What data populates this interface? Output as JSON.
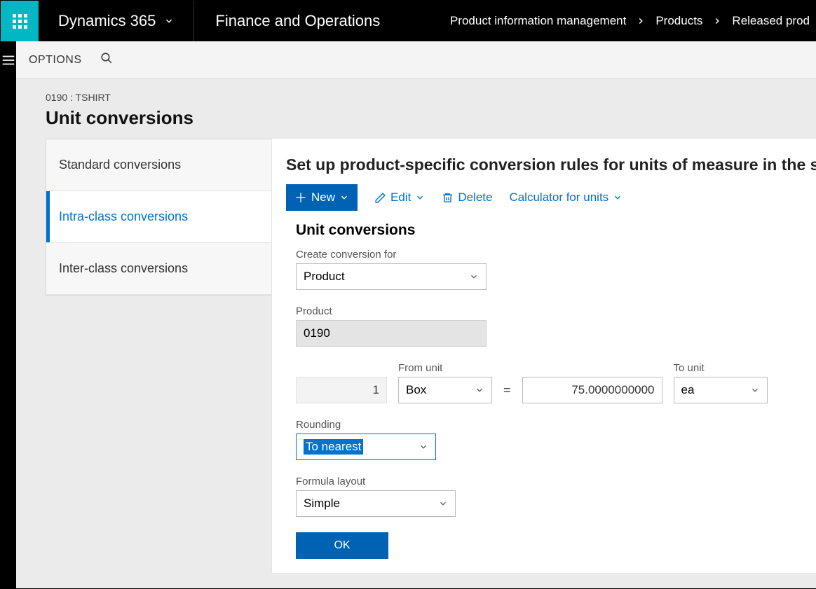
{
  "header": {
    "brand": "Dynamics 365",
    "module": "Finance and Operations",
    "breadcrumbs": [
      "Product information management",
      "Products",
      "Released prod"
    ]
  },
  "options_bar": {
    "label": "OPTIONS"
  },
  "page": {
    "caption": "0190 : TSHIRT",
    "title": "Unit conversions"
  },
  "side_tabs": [
    {
      "label": "Standard conversions",
      "active": false
    },
    {
      "label": "Intra-class conversions",
      "active": true
    },
    {
      "label": "Inter-class conversions",
      "active": false
    }
  ],
  "panel": {
    "heading": "Set up product-specific conversion rules for units of measure in the sam",
    "toolbar": {
      "new": "New",
      "edit": "Edit",
      "delete": "Delete",
      "calculator": "Calculator for units"
    },
    "form": {
      "title": "Unit conversions",
      "create_for_label": "Create conversion for",
      "create_for_value": "Product",
      "product_label": "Product",
      "product_value": "0190",
      "from_qty": "1",
      "from_unit_label": "From unit",
      "from_unit_value": "Box",
      "equals": "=",
      "to_qty": "75.0000000000",
      "to_unit_label": "To unit",
      "to_unit_value": "ea",
      "rounding_label": "Rounding",
      "rounding_value": "To nearest",
      "formula_label": "Formula layout",
      "formula_value": "Simple",
      "ok": "OK"
    }
  }
}
